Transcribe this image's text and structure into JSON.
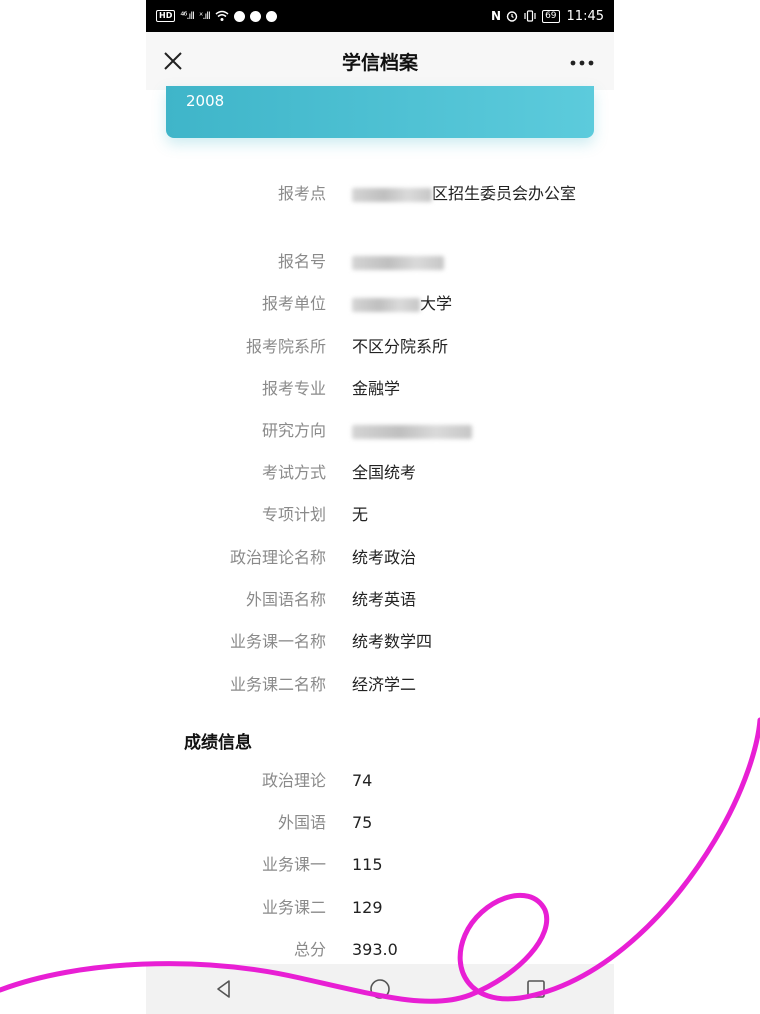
{
  "status_bar": {
    "hd": "HD",
    "signal1": "⁴⁶.ıll",
    "signal2": "ˣ.ıll",
    "battery": "69",
    "time": "11:45"
  },
  "nav": {
    "close_icon": "close-icon",
    "title": "学信档案",
    "more_icon": "more-icon"
  },
  "card": {
    "year": "2008"
  },
  "details": [
    {
      "label": "报考点",
      "value_visible": "区招生委员会办公室"
    },
    {
      "label": "报名号",
      "value_visible": ""
    },
    {
      "label": "报考单位",
      "value_visible": "大学"
    },
    {
      "label": "报考院系所",
      "value_visible": "不区分院系所"
    },
    {
      "label": "报考专业",
      "value_visible": "金融学"
    },
    {
      "label": "研究方向",
      "value_visible": ""
    },
    {
      "label": "考试方式",
      "value_visible": "全国统考"
    },
    {
      "label": "专项计划",
      "value_visible": "无"
    },
    {
      "label": "政治理论名称",
      "value_visible": "统考政治"
    },
    {
      "label": "外国语名称",
      "value_visible": "统考英语"
    },
    {
      "label": "业务课一名称",
      "value_visible": "统考数学四"
    },
    {
      "label": "业务课二名称",
      "value_visible": "经济学二"
    }
  ],
  "scores_section": {
    "title": "成绩信息",
    "rows": [
      {
        "label": "政治理论",
        "value": "74"
      },
      {
        "label": "外国语",
        "value": "75"
      },
      {
        "label": "业务课一",
        "value": "115"
      },
      {
        "label": "业务课二",
        "value": "129"
      },
      {
        "label": "总分",
        "value": "393.0"
      }
    ]
  },
  "colors": {
    "card_start": "#3fb5c9",
    "card_end": "#5ccbdc",
    "decor_stroke": "#e81fd4",
    "label": "#8a8a8a",
    "value": "#222222"
  }
}
